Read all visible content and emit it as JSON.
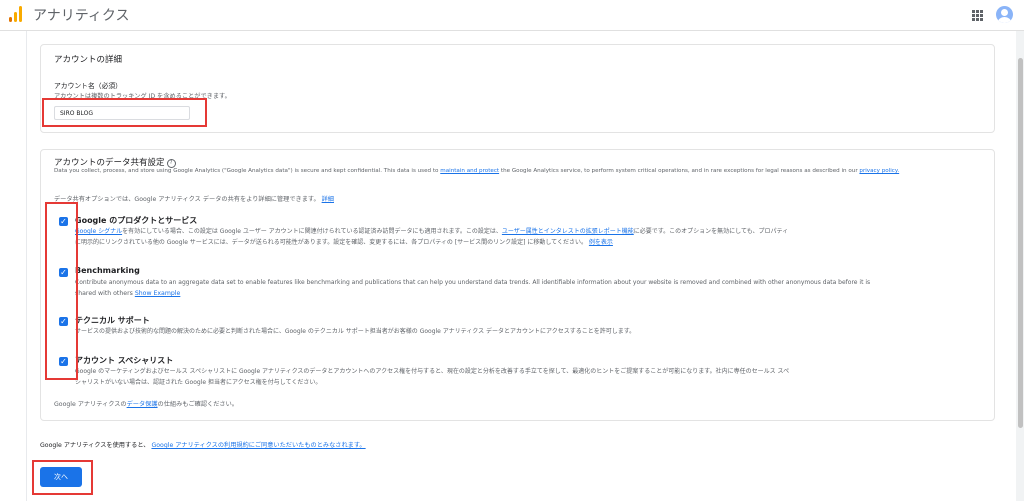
{
  "app": {
    "title": "アナリティクス",
    "brand_colors": [
      "#f9ab00",
      "#e37400"
    ]
  },
  "account": {
    "section_title": "アカウントの詳細",
    "name_label": "アカウント名（必須）",
    "help": "アカウントは複数のトラッキング ID を含めることができます。",
    "input_value": "SIRO BLOG"
  },
  "sharing": {
    "title": "アカウントのデータ共有設定",
    "help_icon": "?",
    "intro_before": "Data you collect, process, and store using Google Analytics (\"Google Analytics data\") is secure and kept confidential. This data is used to ",
    "intro_link": "maintain and protect",
    "intro_after": " the Google Analytics service, to perform system critical operations, and in rare exceptions for legal reasons as described in our ",
    "privacy_link": "privacy policy.",
    "options_lead": "データ共有オプションでは、Google アナリティクス データの共有をより詳細に管理できます。",
    "options_link": "詳細",
    "options": [
      {
        "title": "Google のプロダクトとサービス",
        "line1_link": "Google シグナル",
        "line1": "を有効にしている場合、この設定は Google ユーザー アカウントに関連付けられている認証済み訪問データにも適用されます。この設定は、",
        "line1_link2": "ユーザー属性とインタレストの拡張レポート機能",
        "line1_after": "に必要です。このオプションを無効にしても、プロパティ",
        "line2": "に明示的にリンクされている他の Google サービスには、データが送られる可能性があります。設定を確認、変更するには、各プロパティの [サービス間のリンク設定] に移動してください。",
        "line2_link": "例を表示"
      },
      {
        "title": "Benchmarking",
        "line1": "Contribute anonymous data to an aggregate data set to enable features like benchmarking and publications that can help you understand data trends. All identifiable information about your website is removed and combined with other anonymous data before it is",
        "line2": "shared with others",
        "line2_link": "Show Example"
      },
      {
        "title": "テクニカル サポート",
        "line1": "サービスの提供および技術的な問題の解決のために必要と判断された場合に、Google のテクニカル サポート担当者がお客様の Google アナリティクス データとアカウントにアクセスすることを許可します。"
      },
      {
        "title": "アカウント スペシャリスト",
        "line1": "Google のマーケティングおよびセールス スペシャリストに Google アナリティクスのデータとアカウントへのアクセス権を付与すると、現在の設定と分析を改善する手立てを探して、最適化のヒントをご提案することが可能になります。社内に専任のセールス スペ",
        "line2": "シャリストがいない場合は、認証された Google 担当者にアクセス権を付与してください。"
      }
    ],
    "protection_before": "Google アナリティクスの",
    "protection_link": "データ保護",
    "protection_after": "の仕組みもご確認ください。"
  },
  "terms_before": "Google アナリティクスを使用すると、",
  "terms_link": "Google アナリティクスの利用規約にご同意いただいたものとみなされます。",
  "next_button": "次へ"
}
